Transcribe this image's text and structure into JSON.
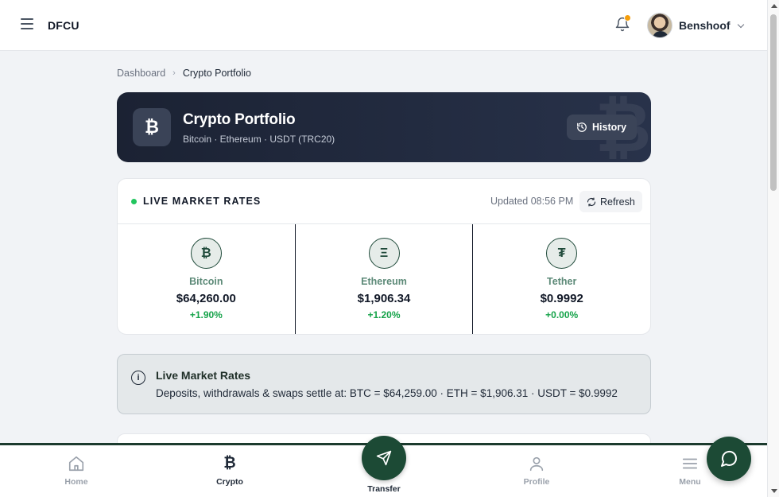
{
  "header": {
    "brand": "DFCU",
    "user_name": "Benshoof",
    "notification_dot_color": "#f59e0b"
  },
  "breadcrumb": {
    "parent": "Dashboard",
    "separator": "›",
    "current": "Crypto Portfolio"
  },
  "hero": {
    "icon": "₿",
    "title": "Crypto Portfolio",
    "subtitle": "Bitcoin · Ethereum · USDT (TRC20)",
    "watermark": "₿",
    "history_label": "History"
  },
  "rates": {
    "title": "LIVE MARKET RATES",
    "updated": "Updated 08:56 PM",
    "refresh_label": "Refresh",
    "coins": [
      {
        "icon": "₿",
        "name": "Bitcoin",
        "price": "$64,260.00",
        "change": "+1.90%"
      },
      {
        "icon": "Ξ",
        "name": "Ethereum",
        "price": "$1,906.34",
        "change": "+1.20%"
      },
      {
        "icon": "₮",
        "name": "Tether",
        "price": "$0.9992",
        "change": "+0.00%"
      }
    ]
  },
  "info": {
    "icon": "i",
    "title": "Live Market Rates",
    "text": "Deposits, withdrawals & swaps settle at: BTC = $64,259.00 · ETH = $1,906.31 · USDT = $0.9992"
  },
  "bottom_nav": {
    "home": "Home",
    "crypto": "Crypto",
    "crypto_icon": "₿",
    "transfer": "Transfer",
    "profile": "Profile",
    "menu": "Menu"
  },
  "colors": {
    "accent_green": "#1c4a35",
    "positive": "#16a34a",
    "live": "#22c55e"
  }
}
